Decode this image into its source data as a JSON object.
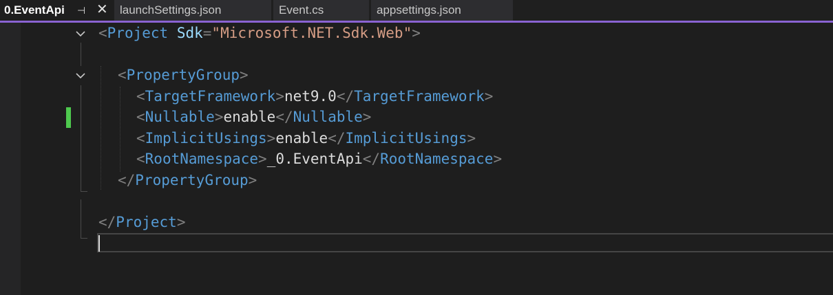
{
  "tabs": [
    {
      "label": "0.EventApi",
      "active": true,
      "pinned": true
    },
    {
      "label": "launchSettings.json",
      "active": false
    },
    {
      "label": "Event.cs",
      "active": false
    },
    {
      "label": "appsettings.json",
      "active": false
    }
  ],
  "colors": {
    "accent": "#8a63d2",
    "change_marker": "#4ec94e",
    "tag": "#569cd6",
    "attribute": "#9cdcfe",
    "string": "#d69d85",
    "punctuation": "#808080",
    "text": "#dcdcdc",
    "background": "#1e1e1e"
  },
  "icons": {
    "pin": "pin-icon",
    "close": "close-icon",
    "fold": "chevron-down-icon"
  },
  "editor": {
    "line1": {
      "open": "<",
      "tag": "Project",
      "space": " ",
      "attr": "Sdk",
      "eq": "=",
      "value": "\"Microsoft.NET.Sdk.Web\"",
      "close": ">"
    },
    "line3": {
      "open": "<",
      "tag": "PropertyGroup",
      "close": ">"
    },
    "line4": {
      "open": "<",
      "tag": "TargetFramework",
      "close": ">",
      "value": "net9.0",
      "open_end": "</",
      "tag_end": "TargetFramework",
      "close_end": ">"
    },
    "line5": {
      "open": "<",
      "tag": "Nullable",
      "close": ">",
      "value": "enable",
      "open_end": "</",
      "tag_end": "Nullable",
      "close_end": ">"
    },
    "line6": {
      "open": "<",
      "tag": "ImplicitUsings",
      "close": ">",
      "value": "enable",
      "open_end": "</",
      "tag_end": "ImplicitUsings",
      "close_end": ">"
    },
    "line7": {
      "open": "<",
      "tag": "RootNamespace",
      "close": ">",
      "value": "_0.EventApi",
      "open_end": "</",
      "tag_end": "RootNamespace",
      "close_end": ">"
    },
    "line8": {
      "open": "</",
      "tag": "PropertyGroup",
      "close": ">"
    },
    "line10": {
      "open": "</",
      "tag": "Project",
      "close": ">"
    }
  }
}
